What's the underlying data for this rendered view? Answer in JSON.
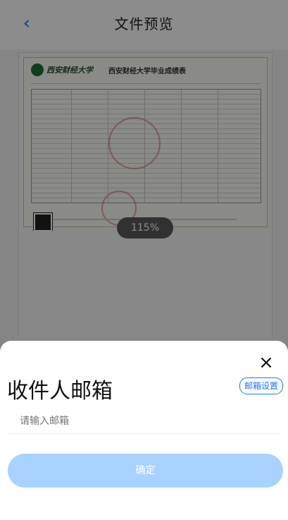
{
  "nav": {
    "back_icon": "‹",
    "title": "文件预览"
  },
  "document": {
    "school_name": "西安财经大学",
    "title": "西安财经大学毕业成绩表"
  },
  "preview": {
    "zoom_label": "115%"
  },
  "sheet": {
    "close_icon": "×",
    "title": "收件人邮箱",
    "mail_settings_label": "邮箱设置",
    "email_placeholder": "请输入邮箱",
    "confirm_label": "确定"
  }
}
